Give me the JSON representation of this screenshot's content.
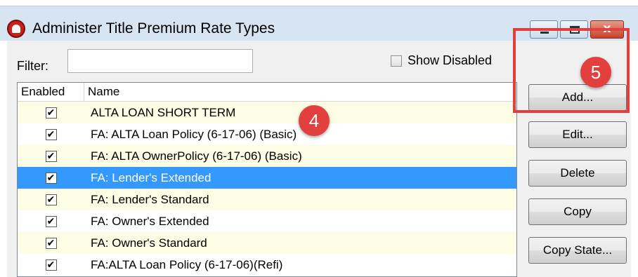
{
  "window": {
    "title": "Administer Title Premium Rate Types",
    "minimize_icon": "minimize-icon",
    "maximize_icon": "maximize-icon",
    "close_icon": "close-icon",
    "close_glyph": "x"
  },
  "filter": {
    "label": "Filter:",
    "value": ""
  },
  "show_disabled": {
    "label": "Show Disabled",
    "checked": false
  },
  "grid": {
    "columns": [
      "Enabled",
      "Name"
    ],
    "rows": [
      {
        "enabled": true,
        "name": "ALTA LOAN SHORT TERM"
      },
      {
        "enabled": true,
        "name": "FA: ALTA Loan Policy (6-17-06) (Basic)"
      },
      {
        "enabled": true,
        "name": "FA: ALTA OwnerPolicy (6-17-06) (Basic)"
      },
      {
        "enabled": true,
        "name": "FA: Lender's Extended"
      },
      {
        "enabled": true,
        "name": "FA: Lender's Standard"
      },
      {
        "enabled": true,
        "name": "FA: Owner's Extended"
      },
      {
        "enabled": true,
        "name": "FA: Owner's Standard"
      },
      {
        "enabled": true,
        "name": "FA:ALTA Loan Policy (6-17-06)(Refi)"
      }
    ],
    "selected_row": 3
  },
  "buttons": {
    "add": "Add...",
    "edit": "Edit...",
    "delete": "Delete",
    "copy": "Copy",
    "copy_state": "Copy State..."
  },
  "annotations": {
    "step_4": "4",
    "step_5": "5"
  },
  "colors": {
    "selection": "#3399ff",
    "alt_row": "#fdfde5",
    "annotation_red": "#e2403f"
  }
}
